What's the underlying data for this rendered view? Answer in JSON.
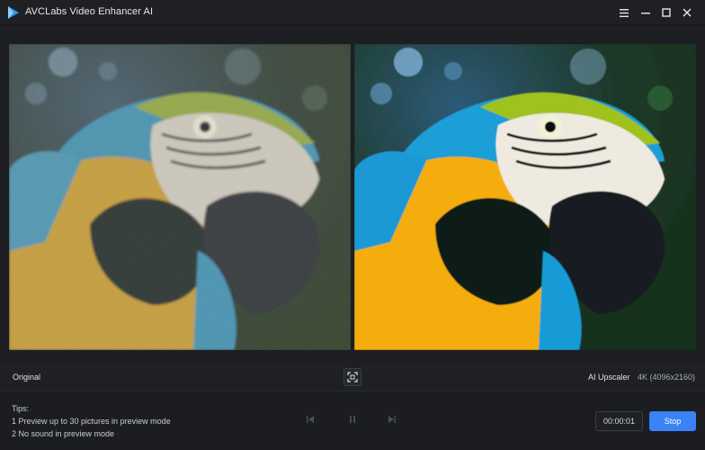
{
  "app": {
    "title": "AVCLabs Video Enhancer AI"
  },
  "preview": {
    "left_label": "Original",
    "right_model": "AI Upscaler",
    "right_resolution": "4K (4096x2160)"
  },
  "tips": {
    "title": "Tips:",
    "items": [
      "1 Preview up to 30 pictures in preview mode",
      "2 No sound in preview mode"
    ]
  },
  "playback": {
    "timecode": "00:00:01",
    "stop_label": "Stop"
  },
  "colors": {
    "accent": "#3a82f6",
    "background": "#1b1d21"
  }
}
